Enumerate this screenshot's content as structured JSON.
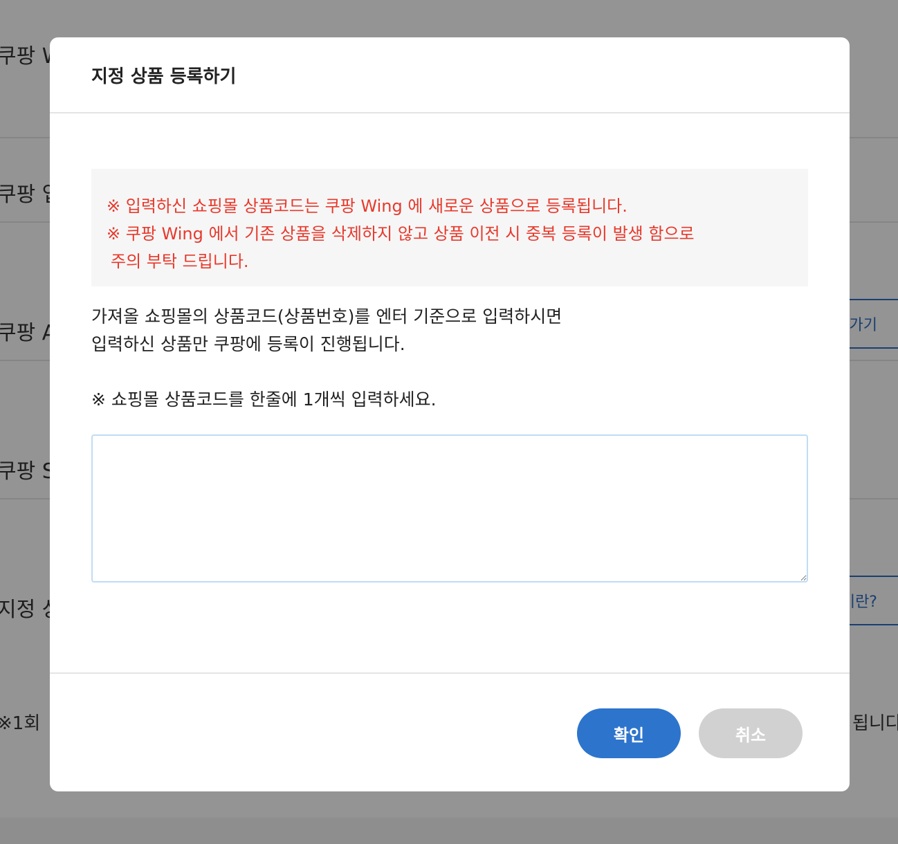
{
  "background": {
    "rows": [
      {
        "label": "쿠팡 W"
      },
      {
        "label": "쿠팡 업"
      },
      {
        "label": "쿠팡 A"
      },
      {
        "label": "쿠팡 S"
      },
      {
        "label": "지정 상"
      }
    ],
    "pill_buttons": [
      {
        "label": "가기"
      },
      {
        "label": "이란?"
      }
    ],
    "note_left": "※1회 ",
    "note_right": "됩니다"
  },
  "modal": {
    "title": "지정 상품 등록하기",
    "warnings": [
      "※ 입력하신 쇼핑몰 상품코드는 쿠팡 Wing 에 새로운 상품으로 등록됩니다.",
      "※ 쿠팡 Wing 에서 기존 상품을 삭제하지 않고 상품 이전 시 중복 등록이 발생 함으로",
      "주의 부탁 드립니다."
    ],
    "description": [
      "가져올 쇼핑몰의 상품코드(상품번호)를 엔터 기준으로 입력하시면",
      "입력하신 상품만 쿠팡에 등록이 진행됩니다."
    ],
    "hint": "※ 쇼핑몰 상품코드를 한줄에 1개씩 입력하세요.",
    "input": {
      "value": "",
      "placeholder": ""
    },
    "buttons": {
      "confirm": "확인",
      "cancel": "취소"
    }
  },
  "colors": {
    "warning_text": "#e8392c",
    "primary_button": "#2d74cc",
    "cancel_button": "#d1d1d1"
  }
}
